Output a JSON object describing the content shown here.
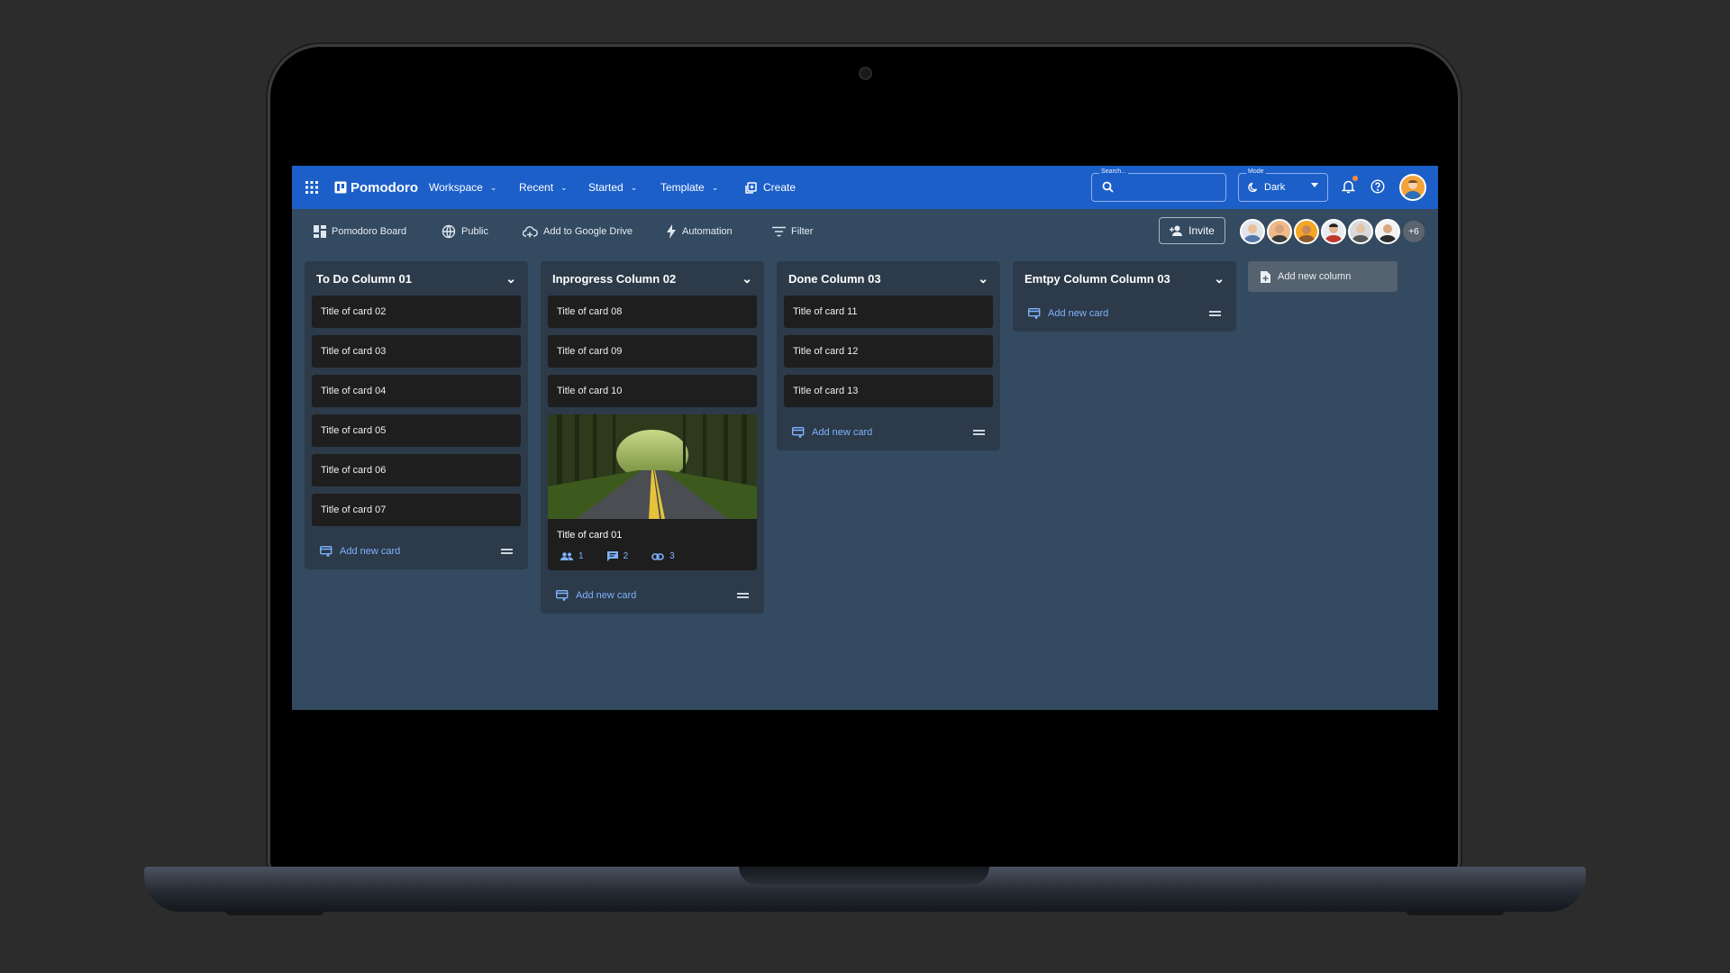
{
  "topbar": {
    "logo": "Pomodoro",
    "menus": [
      {
        "label": "Workspace"
      },
      {
        "label": "Recent"
      },
      {
        "label": "Started"
      },
      {
        "label": "Template"
      }
    ],
    "create_label": "Create",
    "search_label": "Search...",
    "mode_label": "Mode",
    "mode_value": "Dark",
    "icons": [
      "apps-grid-icon",
      "board-logo-icon",
      "search-icon",
      "moon-icon",
      "bell-icon",
      "help-icon"
    ]
  },
  "toolbar": {
    "board_name": "Pomodoro Board",
    "visibility": "Public",
    "drive": "Add to Google Drive",
    "automation": "Automation",
    "filter": "Filter",
    "invite": "Invite",
    "more_members": "+6"
  },
  "columns": [
    {
      "title": "To Do Column 01",
      "cards": [
        "Title of card 02",
        "Title of card 03",
        "Title of card 04",
        "Title of card 05",
        "Title of card 06",
        "Title of card 07"
      ],
      "add_label": "Add new card"
    },
    {
      "title": "Inprogress Column 02",
      "cards": [
        "Title of card 08",
        "Title of card 09",
        "Title of card 10"
      ],
      "image_card": {
        "title": "Title of card 01",
        "members": "1",
        "comments": "2",
        "attachments": "3"
      },
      "add_label": "Add new card"
    },
    {
      "title": "Done Column 03",
      "cards": [
        "Title of card 11",
        "Title of card 12",
        "Title of card 13"
      ],
      "add_label": "Add new card"
    },
    {
      "title": "Emtpy Column Column 03",
      "cards": [],
      "add_label": "Add new card"
    }
  ],
  "add_column_label": "Add new column",
  "colors": {
    "topbar": "#1c5fc9",
    "board_bg": "#334a60",
    "column_bg": "#2c3a49",
    "card_bg": "#1e1e1e",
    "link": "#7fb2ff",
    "notif": "#ff8a3d"
  }
}
